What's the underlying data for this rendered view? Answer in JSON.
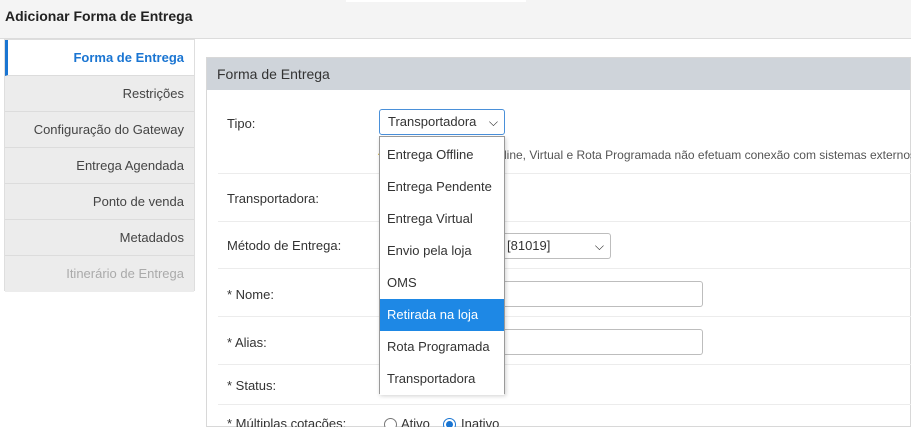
{
  "header": {
    "title": "Adicionar Forma de Entrega"
  },
  "sidebar": {
    "items": [
      {
        "label": "Forma de Entrega"
      },
      {
        "label": "Restrições"
      },
      {
        "label": "Configuração do Gateway"
      },
      {
        "label": "Entrega Agendada"
      },
      {
        "label": "Ponto de venda"
      },
      {
        "label": "Metadados"
      },
      {
        "label": "Itinerário de Entrega"
      }
    ]
  },
  "panel": {
    "title": "Forma de Entrega"
  },
  "form": {
    "tipo_label": "Tipo:",
    "tipo_value": "Transportadora",
    "hint": "line, Virtual e Rota Programada não efetuam conexão com sistemas externos",
    "transportadora_label": "Transportadora:",
    "metodo_label": "Método de Entrega:",
    "metodo_value": "[81019]",
    "nome_label": "* Nome:",
    "alias_label": "* Alias:",
    "status_label": "* Status:",
    "multiplas_label": "* Múltiplas cotações:",
    "ativo_label": "Ativo",
    "inativo_label": "Inativo"
  },
  "dropdown": {
    "options": [
      {
        "label": "Entrega Offline"
      },
      {
        "label": "Entrega Pendente"
      },
      {
        "label": "Entrega Virtual"
      },
      {
        "label": "Envio pela loja"
      },
      {
        "label": "OMS"
      },
      {
        "label": "Retirada na loja"
      },
      {
        "label": "Rota Programada"
      },
      {
        "label": "Transportadora"
      }
    ],
    "highlighted": "Retirada na loja"
  },
  "colors": {
    "accent": "#1a75d2",
    "highlight": "#1e88e5",
    "panel_header": "#cfd4da"
  }
}
